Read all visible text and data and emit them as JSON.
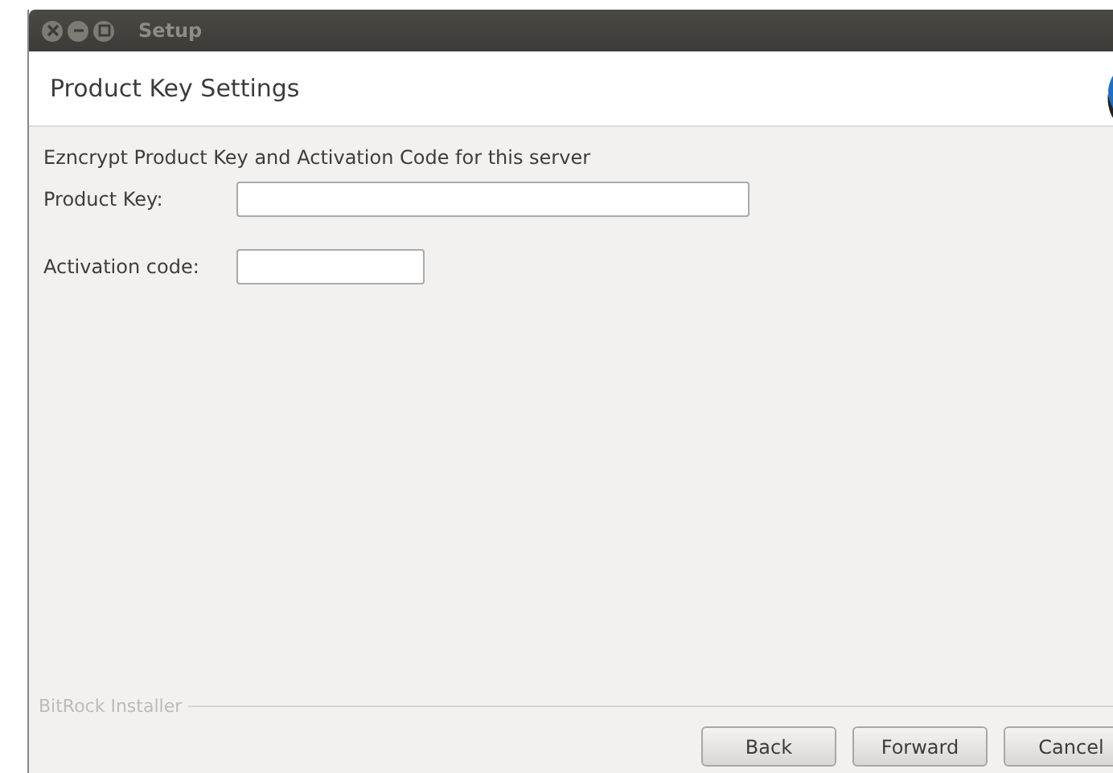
{
  "window": {
    "title": "Setup"
  },
  "header": {
    "title": "Product Key Settings"
  },
  "description": "Ezncrypt Product Key and Activation Code for this server",
  "fields": [
    {
      "label": "Product Key:"
    },
    {
      "label": "Activation code:"
    }
  ],
  "footer": {
    "brand": "BitRock Installer"
  },
  "buttons": [
    "Back",
    "Forward",
    "Cancel"
  ]
}
